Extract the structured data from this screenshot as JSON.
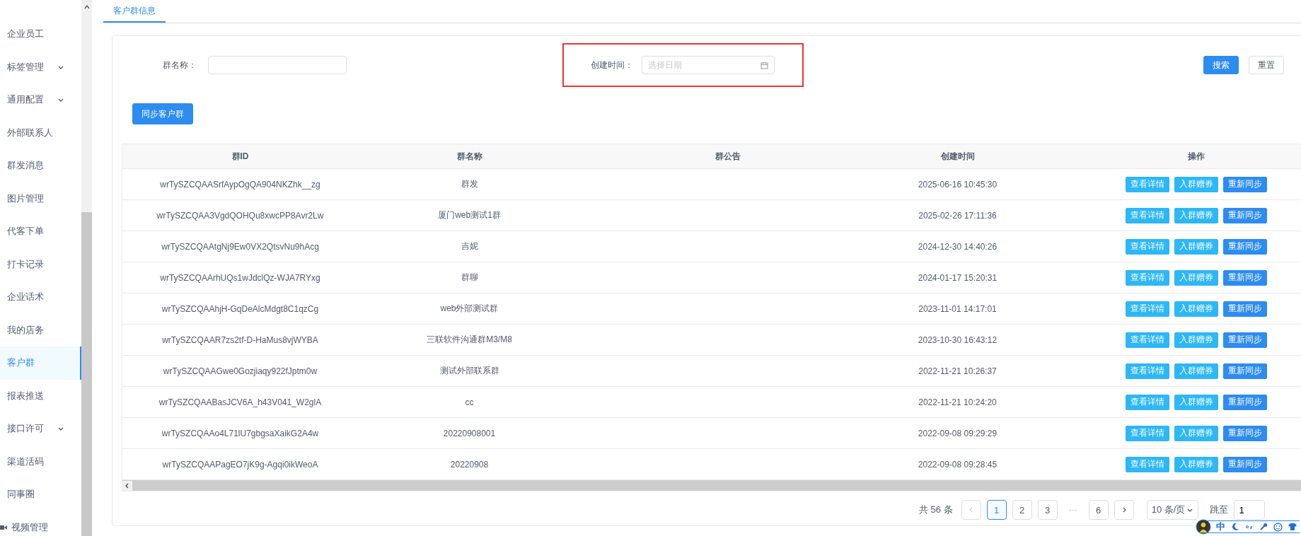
{
  "sidebar": {
    "items": [
      {
        "label": "企业员工",
        "selected": false,
        "expandable": false
      },
      {
        "label": "标签管理",
        "selected": false,
        "expandable": true
      },
      {
        "label": "通用配置",
        "selected": false,
        "expandable": true
      },
      {
        "label": "外部联系人",
        "selected": false,
        "expandable": false
      },
      {
        "label": "群发消息",
        "selected": false,
        "expandable": false
      },
      {
        "label": "图片管理",
        "selected": false,
        "expandable": false
      },
      {
        "label": "代客下单",
        "selected": false,
        "expandable": false
      },
      {
        "label": "打卡记录",
        "selected": false,
        "expandable": false
      },
      {
        "label": "企业话术",
        "selected": false,
        "expandable": false
      },
      {
        "label": "我的店务",
        "selected": false,
        "expandable": false
      },
      {
        "label": "客户群",
        "selected": true,
        "expandable": false
      },
      {
        "label": "报表推送",
        "selected": false,
        "expandable": false
      },
      {
        "label": "接口许可",
        "selected": false,
        "expandable": true
      },
      {
        "label": "渠道活码",
        "selected": false,
        "expandable": false
      },
      {
        "label": "同事圈",
        "selected": false,
        "expandable": false
      },
      {
        "label": "视频管理",
        "selected": false,
        "expandable": false,
        "kind": "video"
      }
    ]
  },
  "tabs": [
    {
      "label": "客户群信息",
      "selected": true
    }
  ],
  "filters": {
    "name_label": "群名称：",
    "date_label": "创建时间：",
    "date_placeholder": "选择日期",
    "date_highlighted": true,
    "search_button": "搜索",
    "reset_button": "重置"
  },
  "sync_button": "同步客户群",
  "table": {
    "columns": [
      "群ID",
      "群名称",
      "群公告",
      "创建时间",
      "操作"
    ],
    "rows": [
      {
        "id": "wrTySZCQAASrfAypOgQA904NKZhk__zg",
        "name": "群发",
        "notice": "",
        "created": "2025-06-16 10:45:30",
        "actions": [
          {
            "label": "查看详情",
            "kind": "info"
          },
          {
            "label": "入群赠券",
            "kind": "info"
          },
          {
            "label": "重新同步",
            "kind": "primary"
          }
        ]
      },
      {
        "id": "wrTySZCQAA3VgdQOHQu8xwcPP8Avr2Lw",
        "name": "厦门web测试1群",
        "notice": "",
        "created": "2025-02-26 17:11:36",
        "actions": [
          {
            "label": "查看详情",
            "kind": "info"
          },
          {
            "label": "入群赠券",
            "kind": "info"
          },
          {
            "label": "重新同步",
            "kind": "primary"
          }
        ]
      },
      {
        "id": "wrTySZCQAAtgNj9Ew0VX2QtsvNu9hAcg",
        "name": "吉妮",
        "notice": "",
        "created": "2024-12-30 14:40:26",
        "actions": [
          {
            "label": "查看详情",
            "kind": "info"
          },
          {
            "label": "入群赠券",
            "kind": "info"
          },
          {
            "label": "重新同步",
            "kind": "primary"
          }
        ]
      },
      {
        "id": "wrTySZCQAArhUQs1wJdclQz-WJA7RYxg",
        "name": "群聊",
        "notice": "",
        "created": "2024-01-17 15:20:31",
        "actions": [
          {
            "label": "查看详情",
            "kind": "info"
          },
          {
            "label": "入群赠券",
            "kind": "info"
          },
          {
            "label": "重新同步",
            "kind": "primary"
          }
        ]
      },
      {
        "id": "wrTySZCQAAhjH-GqDeAlcMdgt8C1qzCg",
        "name": "web外部测试群",
        "notice": "",
        "created": "2023-11-01 14:17:01",
        "actions": [
          {
            "label": "查看详情",
            "kind": "info"
          },
          {
            "label": "入群赠券",
            "kind": "info"
          },
          {
            "label": "重新同步",
            "kind": "primary"
          }
        ]
      },
      {
        "id": "wrTySZCQAAR7zs2tf-D-HaMus8vjWYBA",
        "name": "三联软件沟通群M3/M8",
        "notice": "",
        "created": "2023-10-30 16:43:12",
        "actions": [
          {
            "label": "查看详情",
            "kind": "info"
          },
          {
            "label": "入群赠券",
            "kind": "info"
          },
          {
            "label": "重新同步",
            "kind": "primary"
          }
        ]
      },
      {
        "id": "wrTySZCQAAGwe0Gozjiaqy922fJptm0w",
        "name": "测试外部联系群",
        "notice": "",
        "created": "2022-11-21 10:26:37",
        "actions": [
          {
            "label": "查看详情",
            "kind": "info"
          },
          {
            "label": "入群赠券",
            "kind": "info"
          },
          {
            "label": "重新同步",
            "kind": "primary"
          }
        ]
      },
      {
        "id": "wrTySZCQAABasJCV6A_h43V041_W2glA",
        "name": "cc",
        "notice": "",
        "created": "2022-11-21 10:24:20",
        "actions": [
          {
            "label": "查看详情",
            "kind": "info"
          },
          {
            "label": "入群赠券",
            "kind": "info"
          },
          {
            "label": "重新同步",
            "kind": "primary"
          }
        ]
      },
      {
        "id": "wrTySZCQAAo4L71lU7gbgsaXaikG2A4w",
        "name": "20220908001",
        "notice": "",
        "created": "2022-09-08 09:29:29",
        "actions": [
          {
            "label": "查看详情",
            "kind": "info"
          },
          {
            "label": "入群赠券",
            "kind": "info"
          },
          {
            "label": "重新同步",
            "kind": "primary"
          }
        ]
      },
      {
        "id": "wrTySZCQAAPagEO7jK9g-Agqi0ikWeoA",
        "name": "20220908",
        "notice": "",
        "created": "2022-09-08 09:28:45",
        "actions": [
          {
            "label": "查看详情",
            "kind": "info"
          },
          {
            "label": "入群赠券",
            "kind": "info"
          },
          {
            "label": "重新同步",
            "kind": "primary"
          }
        ]
      }
    ]
  },
  "pagination": {
    "total": "共 56 条",
    "pages": [
      {
        "label": "1",
        "selected": true
      },
      {
        "label": "2",
        "selected": false
      },
      {
        "label": "3",
        "selected": false
      },
      {
        "label": "···",
        "selected": false,
        "kind": "ellipsis"
      },
      {
        "label": "6",
        "selected": false
      }
    ],
    "page_size": "10 条/页",
    "jump_label": "跳至",
    "jump_value": "1"
  },
  "ime_toolbar": {
    "mode": "中"
  }
}
